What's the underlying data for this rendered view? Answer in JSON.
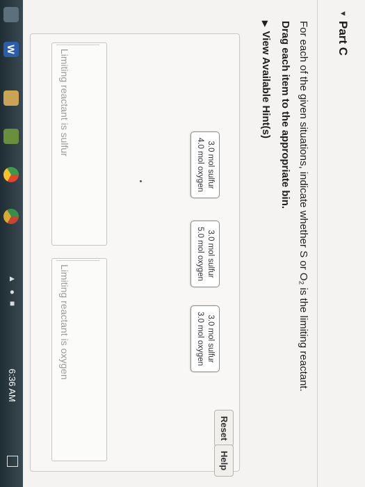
{
  "part": {
    "title": "Part C"
  },
  "instructions": {
    "text": "For each of the given situations, indicate whether S or O₂ is the limiting reactant.",
    "sub": "Drag each item to the appropriate bin.",
    "hints": "View Available Hint(s)"
  },
  "items": [
    {
      "line1": "3.0 mol sulfur",
      "line2": "4.0 mol oxygen"
    },
    {
      "line1": "3.0 mol sulfur",
      "line2": "5.0 mol oxygen"
    },
    {
      "line1": "3.0 mol sulfur",
      "line2": "3.0 mol oxygen"
    }
  ],
  "buttons": {
    "reset": "Reset",
    "help": "Help"
  },
  "bins": {
    "left": "Limiting reactant is sulfur",
    "right": "Limiting reactant is oxygen"
  },
  "taskbar": {
    "clock": "6:36 AM",
    "word_icon": "W"
  }
}
